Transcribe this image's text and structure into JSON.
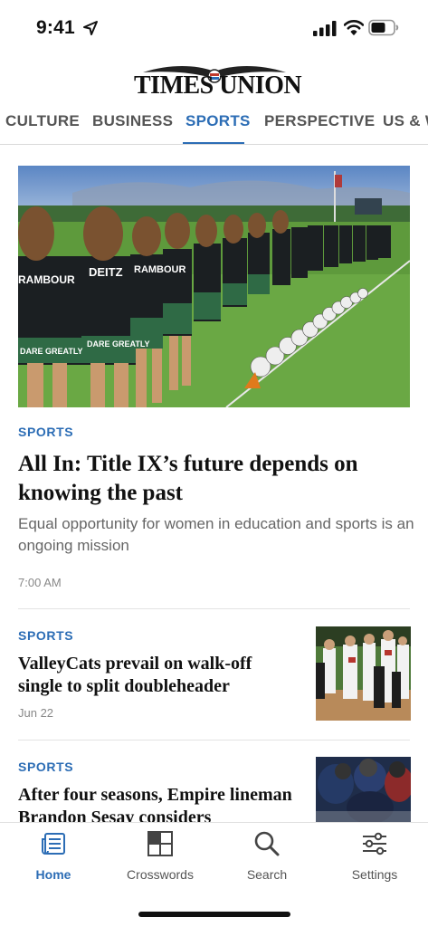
{
  "status_bar": {
    "time": "9:41",
    "icons": [
      "location-arrow-icon",
      "cellular-signal-icon",
      "wifi-icon",
      "battery-icon"
    ]
  },
  "masthead": {
    "logo_text": "TIMES UNION"
  },
  "sections": {
    "tabs": [
      {
        "label": "CULTURE",
        "active": false
      },
      {
        "label": "BUSINESS",
        "active": false
      },
      {
        "label": "SPORTS",
        "active": true
      },
      {
        "label": "PERSPECTIVE",
        "active": false
      },
      {
        "label": "US & W",
        "active": false
      }
    ]
  },
  "hero": {
    "image": "girls soccer team lined up with soccer balls",
    "jersey_text": [
      "RAMBOUR",
      "DEITZ",
      "RAMBOUR",
      "DARE GREATLY"
    ],
    "kicker": "SPORTS",
    "headline": "All In: Title IX’s future depends on knowing the past",
    "dek": "Equal opportunity for women in education and sports is an ongoing mission",
    "time": "7:00 AM"
  },
  "stories": [
    {
      "kicker": "SPORTS",
      "headline": "ValleyCats prevail on walk-off single to split doubleheader",
      "date": "Jun 22",
      "thumb": "baseball players celebrating"
    },
    {
      "kicker": "SPORTS",
      "headline": "After four seasons, Empire lineman Brandon Sesay considers",
      "date": "",
      "thumb": "football players celebrating"
    }
  ],
  "tabbar": {
    "items": [
      {
        "label": "Home",
        "icon": "home-newspaper-icon",
        "active": true
      },
      {
        "label": "Crosswords",
        "icon": "crossword-grid-icon",
        "active": false
      },
      {
        "label": "Search",
        "icon": "search-icon",
        "active": false
      },
      {
        "label": "Settings",
        "icon": "sliders-icon",
        "active": false
      }
    ]
  },
  "colors": {
    "accent": "#2c6db5",
    "text": "#111111",
    "muted": "#666666"
  }
}
